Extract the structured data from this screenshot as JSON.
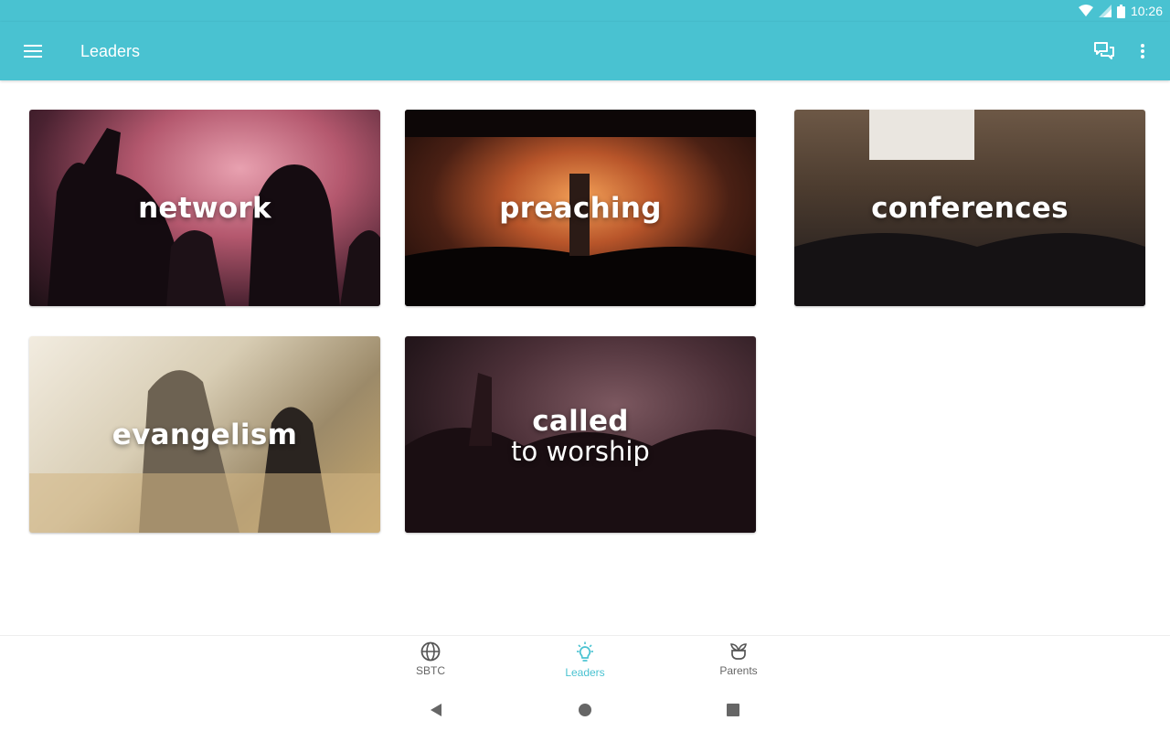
{
  "status": {
    "time": "10:26"
  },
  "appbar": {
    "title": "Leaders",
    "menu_icon": "hamburger-menu-icon",
    "chat_icon": "chat-icon",
    "more_icon": "more-vert-icon"
  },
  "tiles": [
    {
      "line1": "network",
      "line2": ""
    },
    {
      "line1": "preaching",
      "line2": ""
    },
    {
      "line1": "conferences",
      "line2": ""
    },
    {
      "line1": "evangelism",
      "line2": ""
    },
    {
      "line1": "called",
      "line2": "to worship"
    }
  ],
  "bottom_nav": {
    "active": "Leaders",
    "items": [
      {
        "label": "SBTC",
        "icon": "globe-icon"
      },
      {
        "label": "Leaders",
        "icon": "lightbulb-icon"
      },
      {
        "label": "Parents",
        "icon": "sprout-icon"
      }
    ]
  },
  "colors": {
    "accent": "#49c2d1",
    "inactive": "#666666"
  }
}
